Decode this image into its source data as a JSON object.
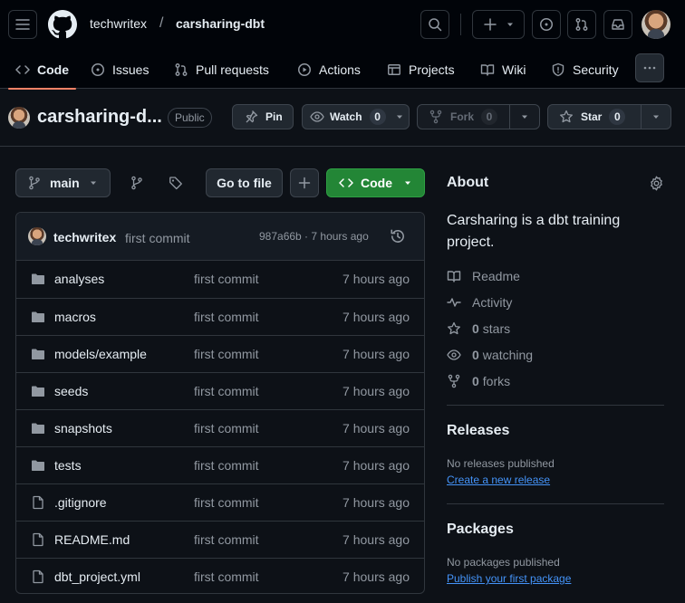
{
  "header": {
    "owner": "techwritex",
    "separator": "/",
    "repo": "carsharing-dbt"
  },
  "nav_tabs": [
    {
      "label": "Code",
      "icon": "code-icon",
      "active": true
    },
    {
      "label": "Issues",
      "icon": "issue-icon"
    },
    {
      "label": "Pull requests",
      "icon": "pull-request-icon"
    },
    {
      "label": "Actions",
      "icon": "play-icon"
    },
    {
      "label": "Projects",
      "icon": "table-icon"
    },
    {
      "label": "Wiki",
      "icon": "book-icon"
    },
    {
      "label": "Security",
      "icon": "shield-icon"
    }
  ],
  "repo_header": {
    "title": "carsharing-d...",
    "visibility": "Public",
    "pin_label": "Pin",
    "watch_label": "Watch",
    "watch_count": "0",
    "fork_label": "Fork",
    "fork_count": "0",
    "star_label": "Star",
    "star_count": "0"
  },
  "toolbar": {
    "branch": "main",
    "go_to_file": "Go to file",
    "code_button": "Code"
  },
  "latest_commit": {
    "author": "techwritex",
    "message": "first commit",
    "meta": "987a66b · 7 hours ago"
  },
  "files": [
    {
      "name": "analyses",
      "type": "folder",
      "message": "first commit",
      "date": "7 hours ago"
    },
    {
      "name": "macros",
      "type": "folder",
      "message": "first commit",
      "date": "7 hours ago"
    },
    {
      "name": "models/example",
      "type": "folder",
      "message": "first commit",
      "date": "7 hours ago"
    },
    {
      "name": "seeds",
      "type": "folder",
      "message": "first commit",
      "date": "7 hours ago"
    },
    {
      "name": "snapshots",
      "type": "folder",
      "message": "first commit",
      "date": "7 hours ago"
    },
    {
      "name": "tests",
      "type": "folder",
      "message": "first commit",
      "date": "7 hours ago"
    },
    {
      "name": ".gitignore",
      "type": "file",
      "message": "first commit",
      "date": "7 hours ago"
    },
    {
      "name": "README.md",
      "type": "file",
      "message": "first commit",
      "date": "7 hours ago"
    },
    {
      "name": "dbt_project.yml",
      "type": "file",
      "message": "first commit",
      "date": "7 hours ago"
    }
  ],
  "about": {
    "heading": "About",
    "description": "Carsharing is a dbt training project.",
    "readme": "Readme",
    "activity": "Activity",
    "stars_count": "0",
    "stars_label": "stars",
    "watching_count": "0",
    "watching_label": "watching",
    "forks_count": "0",
    "forks_label": "forks"
  },
  "releases": {
    "heading": "Releases",
    "status": "No releases published",
    "link": "Create a new release"
  },
  "packages": {
    "heading": "Packages",
    "status": "No packages published",
    "link": "Publish your first package"
  },
  "colors": {
    "background": "#0d1117",
    "header_bg": "#010409",
    "accent_underline": "#f78166",
    "green_button": "#238636",
    "link": "#4493f8"
  }
}
